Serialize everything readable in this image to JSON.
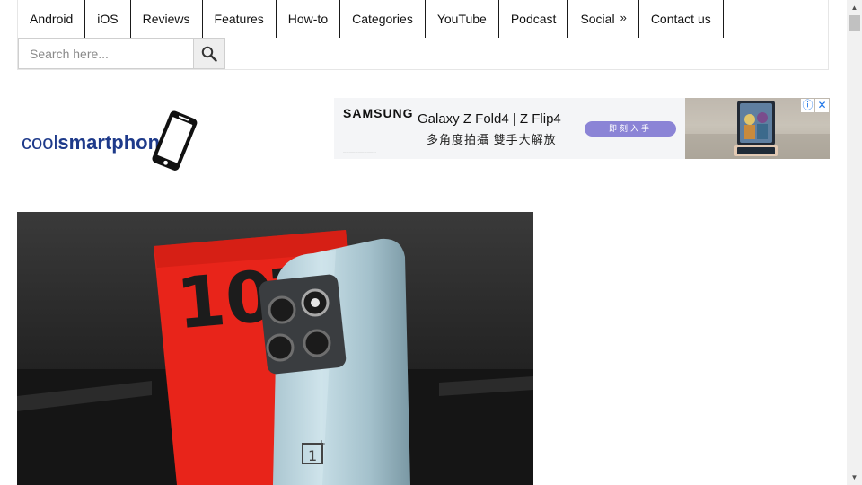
{
  "nav": {
    "items": [
      {
        "label": "Android"
      },
      {
        "label": "iOS"
      },
      {
        "label": "Reviews"
      },
      {
        "label": "Features"
      },
      {
        "label": "How-to"
      },
      {
        "label": "Categories"
      },
      {
        "label": "YouTube"
      },
      {
        "label": "Podcast"
      },
      {
        "label": "Social",
        "suffix": "»"
      },
      {
        "label": "Contact us"
      }
    ]
  },
  "search": {
    "placeholder": "Search here..."
  },
  "logo": {
    "text_regular": "cool",
    "text_bold": "smartphone"
  },
  "ad": {
    "brand": "SAMSUNG",
    "model": "Galaxy Z Fold4 | Z Flip4",
    "subline": "多角度拍攝 雙手大解放",
    "cta": "即刻入手",
    "info_icon": "ⓘ",
    "close_icon": "✕"
  },
  "hero": {
    "box_text": "10T"
  },
  "colors": {
    "logo": "#1e3a8a",
    "box_red": "#e8241a",
    "phone": "#a9c4cf",
    "cta": "#8b84d6"
  }
}
